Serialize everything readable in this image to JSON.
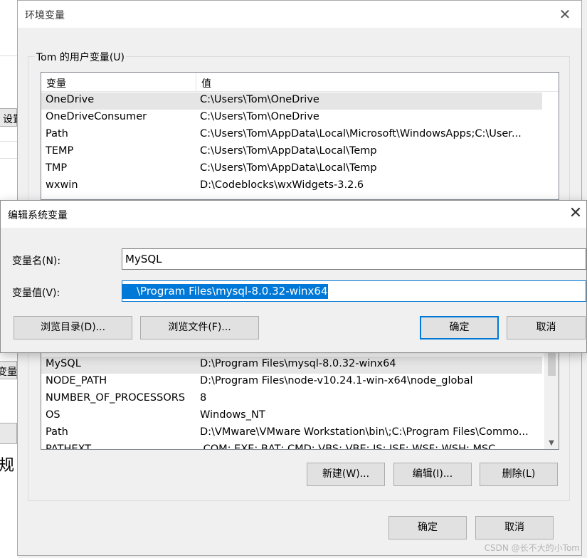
{
  "background": {
    "frag_settings": "设置",
    "frag_variable": "变量",
    "frag_rule": "规"
  },
  "env_window": {
    "title": "环境变量",
    "close_glyph": "✕",
    "user_group_label": "Tom 的用户变量(U)",
    "user_table": {
      "headers": [
        "变量",
        "值"
      ],
      "rows": [
        {
          "name": "OneDrive",
          "value": "C:\\Users\\Tom\\OneDrive"
        },
        {
          "name": "OneDriveConsumer",
          "value": "C:\\Users\\Tom\\OneDrive"
        },
        {
          "name": "Path",
          "value": "C:\\Users\\Tom\\AppData\\Local\\Microsoft\\WindowsApps;C:\\User..."
        },
        {
          "name": "TEMP",
          "value": "C:\\Users\\Tom\\AppData\\Local\\Temp"
        },
        {
          "name": "TMP",
          "value": "C:\\Users\\Tom\\AppData\\Local\\Temp"
        },
        {
          "name": "wxwin",
          "value": "D:\\Codeblocks\\wxWidgets-3.2.6"
        }
      ]
    },
    "system_table": {
      "rows": [
        {
          "name": "MySQL",
          "value": "D:\\Program Files\\mysql-8.0.32-winx64"
        },
        {
          "name": "NODE_PATH",
          "value": "D:\\Program Files\\node-v10.24.1-win-x64\\node_global"
        },
        {
          "name": "NUMBER_OF_PROCESSORS",
          "value": "8"
        },
        {
          "name": "OS",
          "value": "Windows_NT"
        },
        {
          "name": "Path",
          "value": "D:\\VMware\\VMware Workstation\\bin\\;C:\\Program Files\\Commo..."
        },
        {
          "name": "PATHEXT",
          "value": ".COM;.EXE;.BAT;.CMD;.VBS;.VBE;.JS;.JSE;.WSF;.WSH;.MSC"
        }
      ]
    },
    "buttons": {
      "new": "新建(W)...",
      "edit": "编辑(I)...",
      "delete": "删除(L)",
      "ok": "确定",
      "cancel": "取消"
    }
  },
  "edit_dialog": {
    "title": "编辑系统变量",
    "close_glyph": "✕",
    "name_label": "变量名(N):",
    "name_value": "MySQL",
    "value_label": "变量值(V):",
    "value_value": "\\Program Files\\mysql-8.0.32-winx64",
    "buttons": {
      "browse_dir": "浏览目录(D)...",
      "browse_file": "浏览文件(F)...",
      "ok": "确定",
      "cancel": "取消"
    }
  },
  "watermark": "CSDN @长不大的小Tom",
  "colors": {
    "accent": "#0078d7",
    "selection_row": "#e5e5e5"
  }
}
